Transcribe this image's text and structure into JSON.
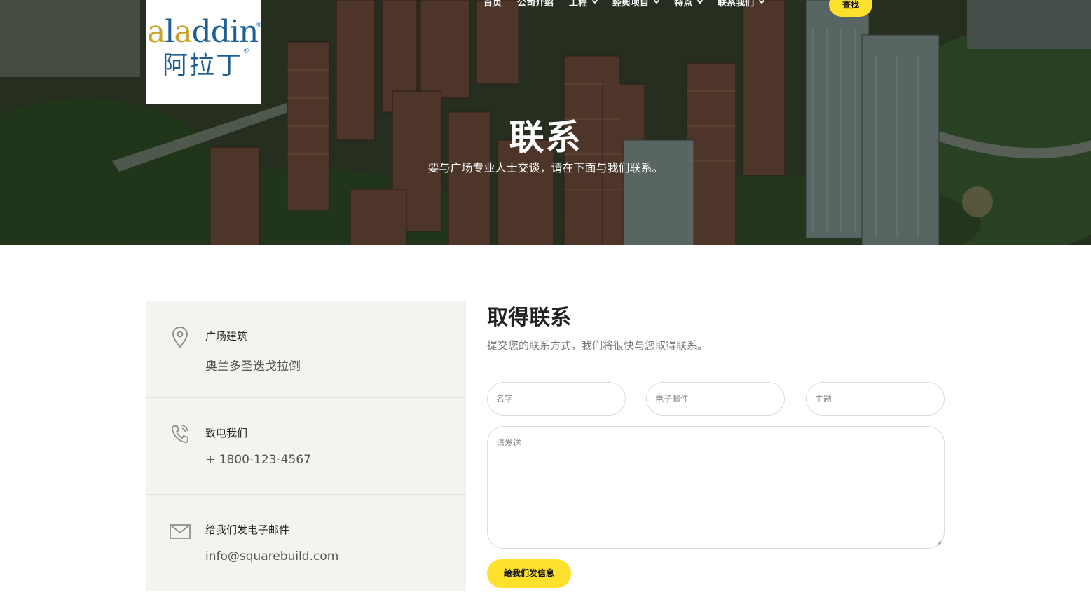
{
  "header": {
    "logo": {
      "latin_a": "a",
      "latin_l": "l",
      "latin_a2": "a",
      "latin_rest": "ddin",
      "chinese": "阿拉丁",
      "registered": "®"
    },
    "nav": [
      {
        "label": "首页",
        "has_dropdown": false
      },
      {
        "label": "公司介绍",
        "has_dropdown": false
      },
      {
        "label": "工程",
        "has_dropdown": true
      },
      {
        "label": "经典项目",
        "has_dropdown": true
      },
      {
        "label": "特点",
        "has_dropdown": true
      },
      {
        "label": "联系我们",
        "has_dropdown": true
      }
    ],
    "search_label": "查找"
  },
  "hero": {
    "title": "联系",
    "subtitle": "要与广场专业人士交谈，请在下面与我们联系。"
  },
  "info": {
    "items": [
      {
        "icon": "location-pin-icon",
        "title": "广场建筑",
        "value": "奥兰多圣迭戈拉倒"
      },
      {
        "icon": "phone-icon",
        "title": "致电我们",
        "value": "+ 1800-123-4567"
      },
      {
        "icon": "mail-icon",
        "title": "给我们发电子邮件",
        "value": "info@squarebuild.com"
      }
    ]
  },
  "form": {
    "title": "取得联系",
    "description": "提交您的联系方式，我们将很快与您取得联系。",
    "name_placeholder": "名字",
    "email_placeholder": "电子邮件",
    "subject_placeholder": "主题",
    "message_placeholder": "请发送",
    "submit_label": "给我们发信息"
  },
  "colors": {
    "accent": "#fde12d",
    "panel_bg": "#f3f3ef",
    "logo_blue": "#1d5f95",
    "logo_gold": "#c9a227"
  }
}
